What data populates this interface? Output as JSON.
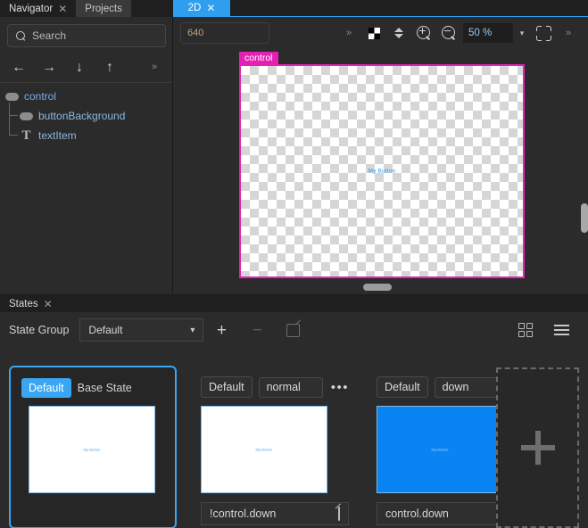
{
  "navigator": {
    "tabs": [
      {
        "label": "Navigator",
        "closable": true,
        "active": true
      },
      {
        "label": "Projects",
        "closable": false,
        "active": false
      }
    ],
    "search": {
      "placeholder": "Search",
      "value": "",
      "icon": "search-icon"
    },
    "toolbar": [
      {
        "name": "move-left",
        "glyph": "←"
      },
      {
        "name": "move-right",
        "glyph": "→"
      },
      {
        "name": "move-down",
        "glyph": "↓"
      },
      {
        "name": "move-up",
        "glyph": "↑"
      },
      {
        "name": "overflow",
        "glyph": "»"
      }
    ],
    "tree": [
      {
        "label": "control",
        "icon": "rounded-rect-icon",
        "depth": 0
      },
      {
        "label": "buttonBackground",
        "icon": "rounded-rect-icon",
        "depth": 1
      },
      {
        "label": "textItem",
        "icon": "text-icon",
        "depth": 1
      }
    ]
  },
  "canvas": {
    "tabs": [
      {
        "label": "2D",
        "closable": true,
        "active": true
      }
    ],
    "toolbar": {
      "width_value": "640",
      "overflow": "»",
      "background_icon": "checkerboard-icon",
      "updown_icon": "stepper-icon",
      "zoom_in_icon": "zoom-in-icon",
      "zoom_out_icon": "zoom-out-icon",
      "zoom_value": "50 %",
      "zoom_caret": "▾",
      "fit_icon": "fit-to-frame-icon",
      "right_overflow": "»"
    },
    "frame": {
      "label": "control",
      "label_color": "#e322b4",
      "border_color": "#e322b4",
      "text": "My Button",
      "text_color": "#2e9fef"
    }
  },
  "states": {
    "tabs": [
      {
        "label": "States",
        "closable": true,
        "active": true
      }
    ],
    "toolbar": {
      "group_label": "State Group",
      "group_value": "Default",
      "add": "+",
      "remove": "−",
      "edit_icon": "edit-icon",
      "grid_view_icon": "grid-view-icon",
      "list_view_icon": "list-view-icon"
    },
    "cards": [
      {
        "selected": true,
        "badge": "Default",
        "badge_style": "blue",
        "title": "Base State",
        "has_name_field": false,
        "thumb_color": "#ffffff",
        "thumb_text": "My Button",
        "menu": null,
        "footer": null
      },
      {
        "selected": false,
        "badge": "Default",
        "badge_style": "dark",
        "name_value": "normal",
        "has_name_field": true,
        "thumb_color": "#ffffff",
        "thumb_text": "My Button",
        "menu": "•••",
        "footer": "!control.down",
        "footer_icon": "edit-icon"
      },
      {
        "selected": false,
        "badge": "Default",
        "badge_style": "dark",
        "name_value": "down",
        "has_name_field": true,
        "thumb_color": "#0b84f3",
        "thumb_text": "My Button",
        "menu": null,
        "footer": "control.down",
        "footer_icon": null
      }
    ],
    "add_card": {
      "name": "add-state-card",
      "glyph": "+"
    }
  }
}
